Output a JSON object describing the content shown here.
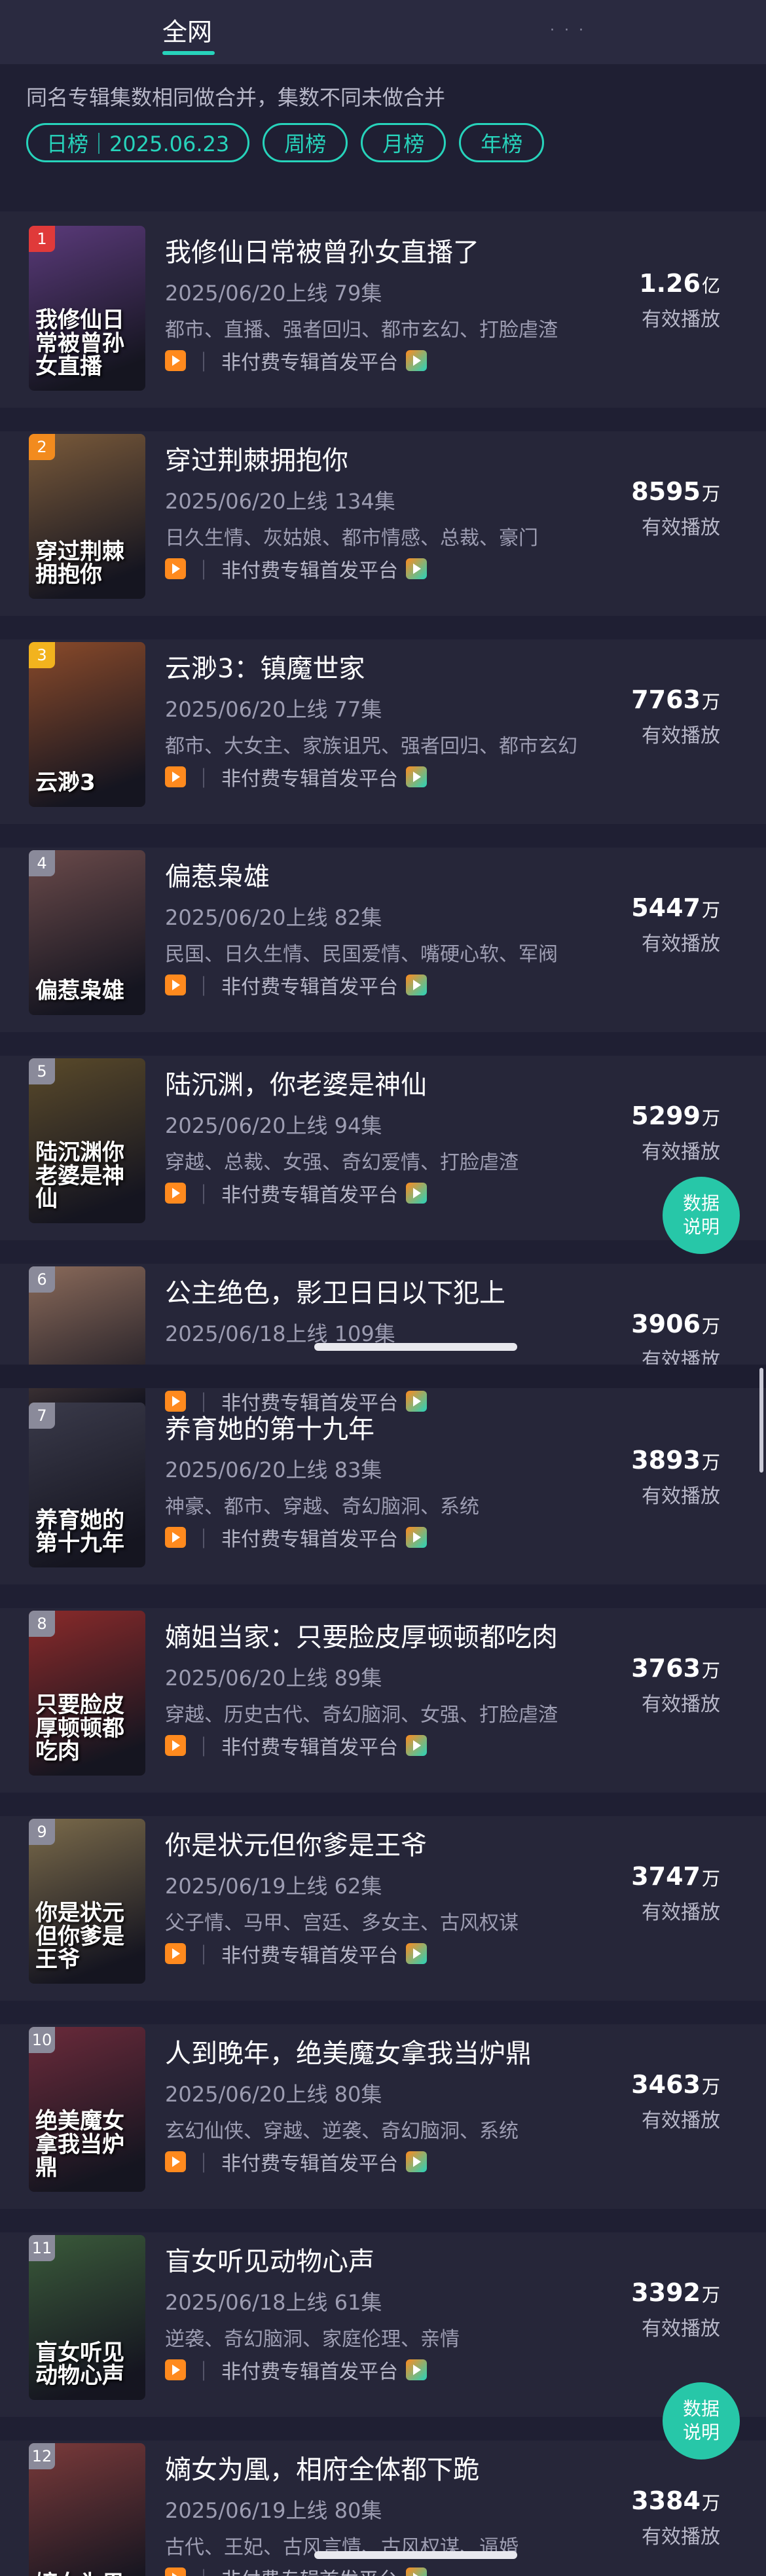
{
  "tabs": {
    "active": "全网"
  },
  "filter": {
    "note": "同名专辑集数相同做合并，集数不同未做合并",
    "chips": [
      "日榜｜2025.06.23",
      "周榜",
      "月榜",
      "年榜"
    ]
  },
  "labels": {
    "platform": "非付费专辑首发平台",
    "separator": "｜",
    "effective": "有效播放",
    "fab_line1": "数据",
    "fab_line2": "说明"
  },
  "items": [
    {
      "rank": "1",
      "title": "我修仙日常被曾孙女直播了",
      "date": "2025/06/20上线 79集",
      "tags": "都市、直播、强者回归、都市玄幻、打脸虐渣",
      "value": "1.26",
      "unit": "亿",
      "cover": "我修仙日常被曾孙女直播",
      "color": "#5a3a7a",
      "rankColor": "#e03a3a"
    },
    {
      "rank": "2",
      "title": "穿过荆棘拥抱你",
      "date": "2025/06/20上线 134集",
      "tags": "日久生情、灰姑娘、都市情感、总裁、豪门",
      "value": "8595",
      "unit": "万",
      "cover": "穿过荆棘拥抱你",
      "color": "#7a5a3a",
      "rankColor": "#f28b1e"
    },
    {
      "rank": "3",
      "title": "云渺3：镇魔世家",
      "date": "2025/06/20上线 77集",
      "tags": "都市、大女主、家族诅咒、强者回归、都市玄幻",
      "value": "7763",
      "unit": "万",
      "cover": "云渺3",
      "color": "#8a4a2a",
      "rankColor": "#f2b31e"
    },
    {
      "rank": "4",
      "title": "偏惹枭雄",
      "date": "2025/06/20上线 82集",
      "tags": "民国、日久生情、民国爱情、嘴硬心软、军阀",
      "value": "5447",
      "unit": "万",
      "cover": "偏惹枭雄",
      "color": "#6a4a4a",
      "rankColor": "#8a8a9a"
    },
    {
      "rank": "5",
      "title": "陆沉渊，你老婆是神仙",
      "date": "2025/06/20上线 94集",
      "tags": "穿越、总裁、女强、奇幻爱情、打脸虐渣",
      "value": "5299",
      "unit": "万",
      "cover": "陆沉渊你老婆是神仙",
      "color": "#5a4a2a",
      "rankColor": "#8a8a9a"
    },
    {
      "rank": "6",
      "title": "公主绝色，影卫日日以下犯上",
      "date": "2025/06/18上线 109集",
      "tags": "",
      "value": "3906",
      "unit": "万",
      "cover": "",
      "color": "#8a6a5a",
      "rankColor": "#8a8a9a"
    },
    {
      "rank": "7",
      "title": "养育她的第十九年",
      "date": "2025/06/20上线 83集",
      "tags": "神豪、都市、穿越、奇幻脑洞、系统",
      "value": "3893",
      "unit": "万",
      "cover": "养育她的第十九年",
      "color": "#3a3a4a",
      "rankColor": "#8a8a9a"
    },
    {
      "rank": "8",
      "title": "嫡姐当家：只要脸皮厚顿顿都吃肉",
      "date": "2025/06/20上线 89集",
      "tags": "穿越、历史古代、奇幻脑洞、女强、打脸虐渣",
      "value": "3763",
      "unit": "万",
      "cover": "只要脸皮厚顿顿都吃肉",
      "color": "#8a2a2a",
      "rankColor": "#8a8a9a"
    },
    {
      "rank": "9",
      "title": "你是状元但你爹是王爷",
      "date": "2025/06/19上线 62集",
      "tags": "父子情、马甲、宫廷、多女主、古风权谋",
      "value": "3747",
      "unit": "万",
      "cover": "你是状元但你爹是王爷",
      "color": "#7a6a4a",
      "rankColor": "#8a8a9a"
    },
    {
      "rank": "10",
      "title": "人到晚年，绝美魔女拿我当炉鼎",
      "date": "2025/06/20上线 80集",
      "tags": "玄幻仙侠、穿越、逆袭、奇幻脑洞、系统",
      "value": "3463",
      "unit": "万",
      "cover": "绝美魔女拿我当炉鼎",
      "color": "#6a2a3a",
      "rankColor": "#8a8a9a"
    },
    {
      "rank": "11",
      "title": "盲女听见动物心声",
      "date": "2025/06/18上线 61集",
      "tags": "逆袭、奇幻脑洞、家庭伦理、亲情",
      "value": "3392",
      "unit": "万",
      "cover": "盲女听见动物心声",
      "color": "#3a5a3a",
      "rankColor": "#8a8a9a"
    },
    {
      "rank": "12",
      "title": "嫡女为凰，相府全体都下跪",
      "date": "2025/06/19上线 80集",
      "tags": "古代、王妃、古风言情、古风权谋、逼婚",
      "value": "3384",
      "unit": "万",
      "cover": "嫡女为凰",
      "color": "#7a3a3a",
      "rankColor": "#8a8a9a"
    }
  ]
}
